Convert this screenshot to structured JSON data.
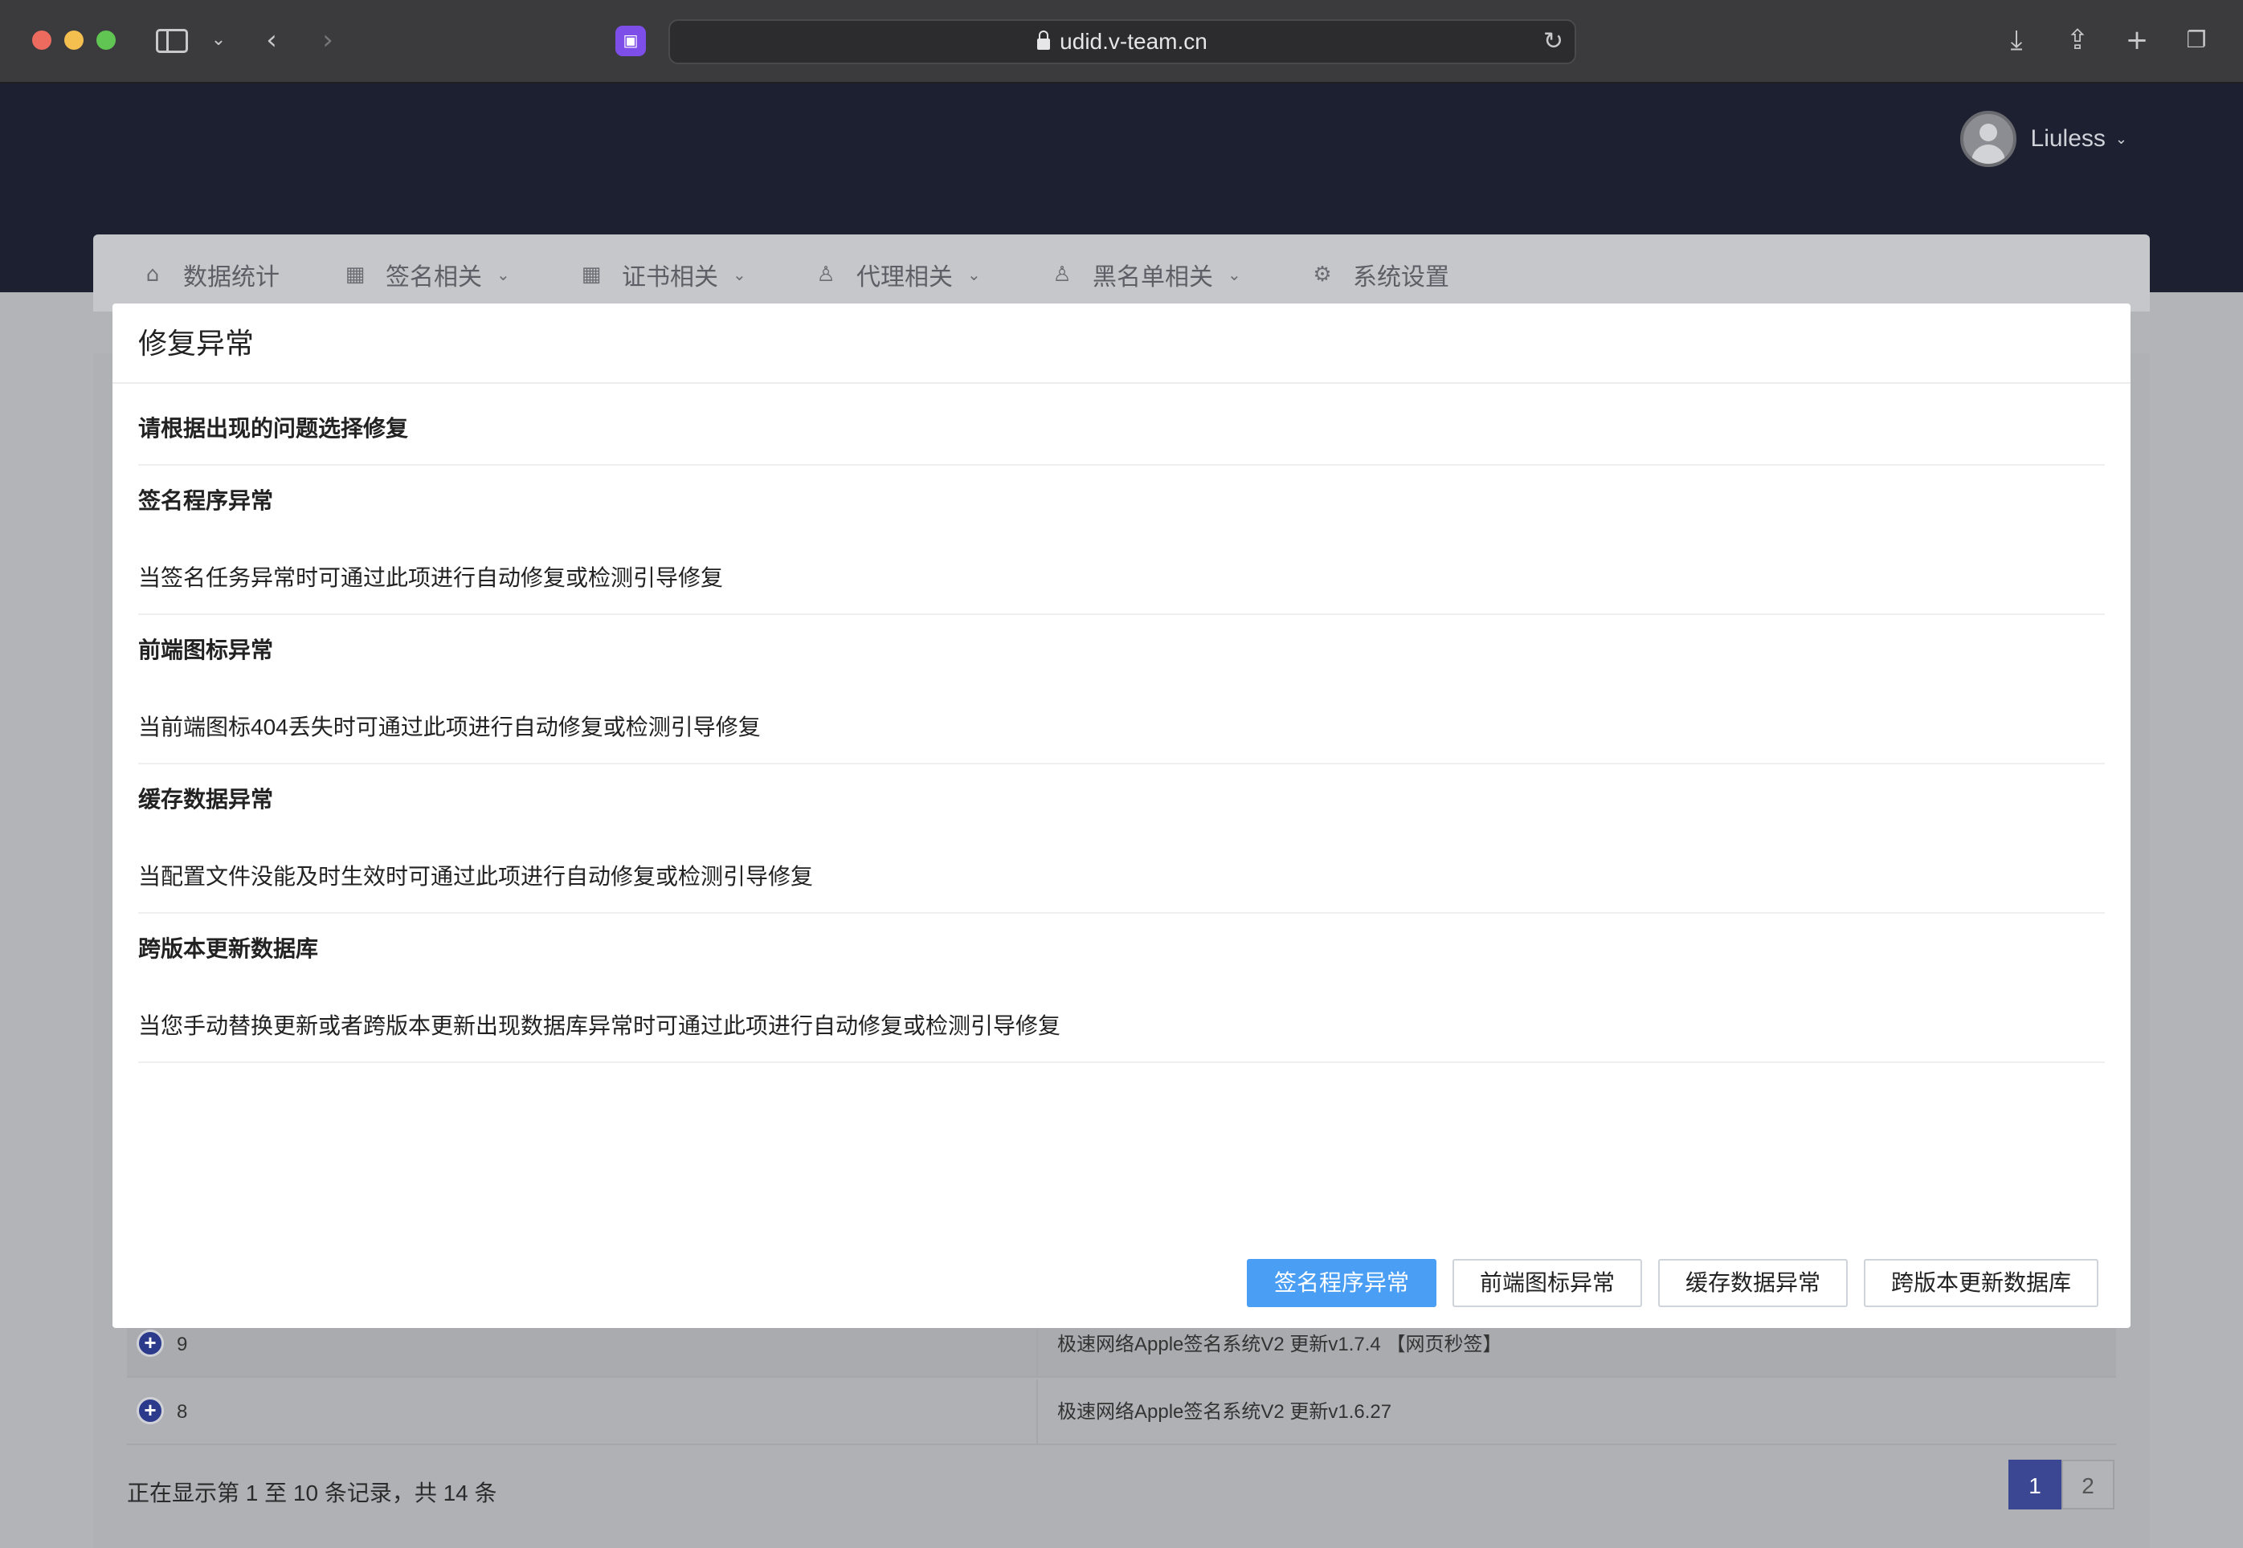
{
  "browser": {
    "url": "udid.v-team.cn",
    "reload_icon": "↻",
    "nav_icons": [
      "sidebar-icon",
      "chevron-down-icon",
      "back-icon",
      "forward-icon"
    ],
    "right_icons": [
      "download-icon",
      "share-icon",
      "new-tab-icon",
      "tabs-overview-icon"
    ]
  },
  "header": {
    "username": "Liuless"
  },
  "nav": {
    "items": [
      {
        "label": "数据统计",
        "icon": "home-icon"
      },
      {
        "label": "签名相关",
        "icon": "grid-icon"
      },
      {
        "label": "证书相关",
        "icon": "grid-icon"
      },
      {
        "label": "代理相关",
        "icon": "users-icon"
      },
      {
        "label": "黑名单相关",
        "icon": "users-icon"
      },
      {
        "label": "系统设置",
        "icon": "gear-icon"
      }
    ]
  },
  "background_table": {
    "rows": [
      {
        "id": "9",
        "desc": "极速网络Apple签名系统V2 更新v1.7.4 【网页秒签】"
      },
      {
        "id": "8",
        "desc": "极速网络Apple签名系统V2 更新v1.6.27"
      }
    ],
    "records_text": "正在显示第 1 至 10 条记录，共 14 条",
    "pages": [
      "1",
      "2"
    ]
  },
  "modal": {
    "title": "修复异常",
    "intro": "请根据出现的问题选择修复",
    "sections": [
      {
        "heading": "签名程序异常",
        "desc": "当签名任务异常时可通过此项进行自动修复或检测引导修复"
      },
      {
        "heading": "前端图标异常",
        "desc": "当前端图标404丢失时可通过此项进行自动修复或检测引导修复"
      },
      {
        "heading": "缓存数据异常",
        "desc": "当配置文件没能及时生效时可通过此项进行自动修复或检测引导修复"
      },
      {
        "heading": "跨版本更新数据库",
        "desc": "当您手动替换更新或者跨版本更新出现数据库异常时可通过此项进行自动修复或检测引导修复"
      }
    ],
    "buttons": [
      "签名程序异常",
      "前端图标异常",
      "缓存数据异常",
      "跨版本更新数据库"
    ]
  },
  "colors": {
    "header_bg": "#1d2030",
    "primary_button": "#4a9ff5",
    "pager_active": "#3b4793"
  }
}
